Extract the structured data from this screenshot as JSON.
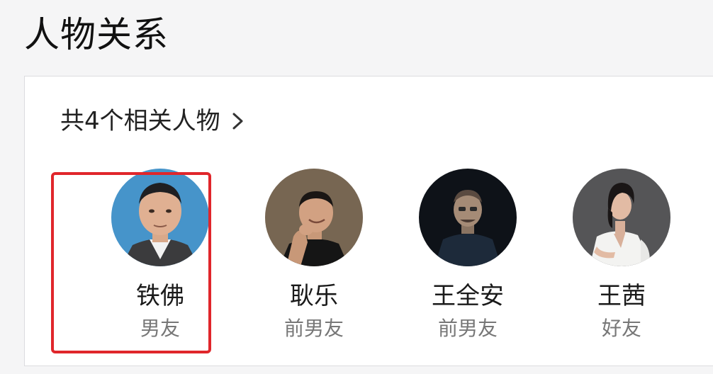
{
  "section": {
    "title": "人物关系"
  },
  "summary": {
    "text": "共4个相关人物",
    "arrow_icon": "chevron-right-icon"
  },
  "people": [
    {
      "name": "铁佛",
      "relation": "男友",
      "avatar_bg": "#3e8cc4",
      "highlighted": true
    },
    {
      "name": "耿乐",
      "relation": "前男友",
      "avatar_bg": "#6b5a48",
      "highlighted": false
    },
    {
      "name": "王全安",
      "relation": "前男友",
      "avatar_bg": "#0e1218",
      "highlighted": false
    },
    {
      "name": "王茜",
      "relation": "好友",
      "avatar_bg": "#4a4a4c",
      "highlighted": false
    }
  ],
  "colors": {
    "highlight_border": "#e0262b",
    "relation_text": "#777777",
    "name_text": "#1a1a1a"
  }
}
